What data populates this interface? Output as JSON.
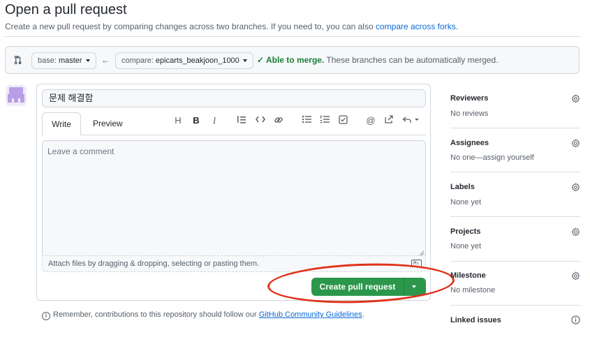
{
  "header": {
    "title": "Open a pull request",
    "subtitle_prefix": "Create a new pull request by comparing changes across two branches. If you need to, you can also ",
    "subtitle_link": "compare across forks",
    "subtitle_suffix": "."
  },
  "branches": {
    "base_prefix": "base: ",
    "base_value": "master",
    "compare_prefix": "compare: ",
    "compare_value": "epicarts_beakjoon_1000",
    "merge_status": "Able to merge.",
    "merge_message": " These branches can be automatically merged."
  },
  "form": {
    "title_value": "문제 해결함",
    "tabs": [
      "Write",
      "Preview"
    ],
    "toolbar": [
      "heading-icon",
      "bold-icon",
      "italic-icon",
      "quote-icon",
      "code-icon",
      "link-icon",
      "bulleted-list-icon",
      "numbered-list-icon",
      "task-list-icon",
      "mention-icon",
      "reference-icon",
      "reply-icon"
    ],
    "comment_placeholder": "Leave a comment",
    "attach_text": "Attach files by dragging & dropping, selecting or pasting them.",
    "markdown_badge": "M↓",
    "submit_label": "Create pull request"
  },
  "footer": {
    "remember_prefix": "Remember, contributions to this repository should follow our ",
    "remember_link": "GitHub Community Guidelines",
    "remember_suffix": "."
  },
  "sidebar": [
    {
      "heading": "Reviewers",
      "value": "No reviews"
    },
    {
      "heading": "Assignees",
      "value": "No one—assign yourself"
    },
    {
      "heading": "Labels",
      "value": "None yet"
    },
    {
      "heading": "Projects",
      "value": "None yet"
    },
    {
      "heading": "Milestone",
      "value": "No milestone"
    },
    {
      "heading": "Linked issues",
      "value": ""
    }
  ],
  "colors": {
    "accent_green": "#2c974b",
    "link_blue": "#0969da",
    "annotation_red": "#e0311b"
  }
}
